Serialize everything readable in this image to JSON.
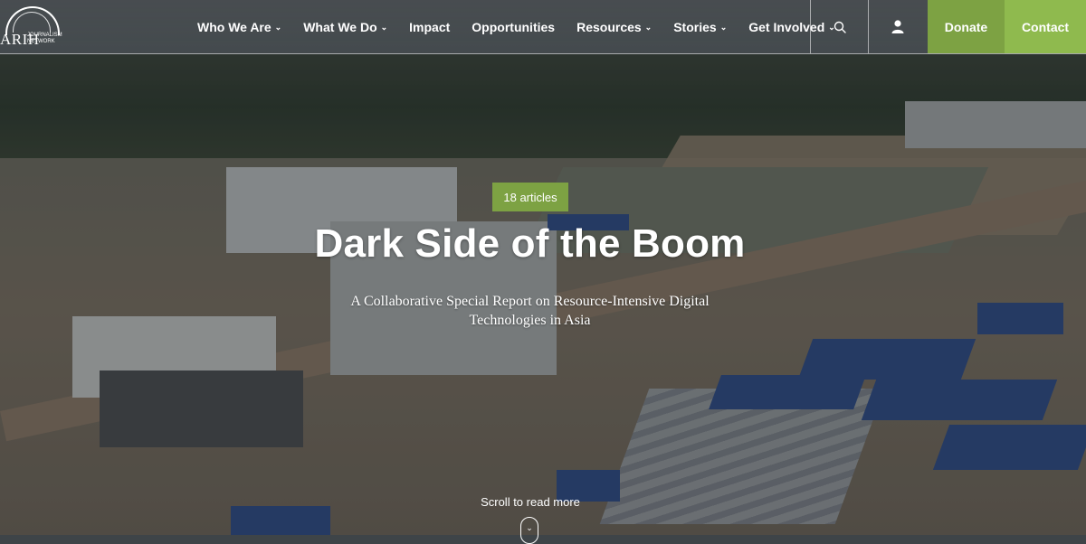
{
  "brand": {
    "logo_mark": "ARIH",
    "logo_sub": "JOURNALISM NETWORK",
    "accent_green": "#7da243",
    "accent_green_light": "#8fba4e"
  },
  "nav": {
    "items": [
      {
        "label": "Who We Are",
        "dropdown": true
      },
      {
        "label": "What We Do",
        "dropdown": true
      },
      {
        "label": "Impact",
        "dropdown": false
      },
      {
        "label": "Opportunities",
        "dropdown": false
      },
      {
        "label": "Resources",
        "dropdown": true
      },
      {
        "label": "Stories",
        "dropdown": true
      },
      {
        "label": "Get Involved",
        "dropdown": true
      }
    ],
    "chevron": "⌄",
    "search_icon": "search-icon",
    "user_icon": "user-icon",
    "donate_label": "Donate",
    "contact_label": "Contact"
  },
  "hero": {
    "badge": "18 articles",
    "title": "Dark Side of the Boom",
    "subtitle": "A Collaborative Special Report on Resource-Intensive Digital Technologies in Asia",
    "scroll_label": "Scroll to read more",
    "scroll_icon": "chevron-down-icon"
  }
}
